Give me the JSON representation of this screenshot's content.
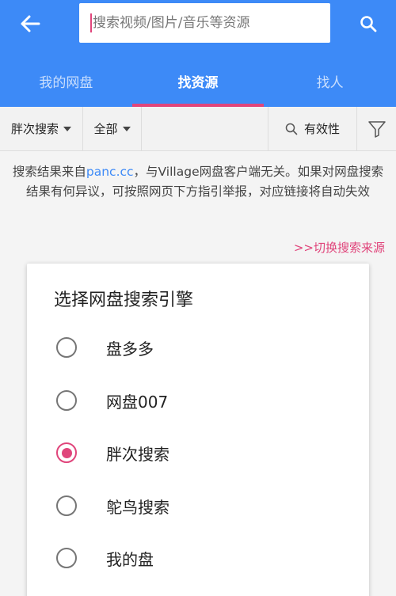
{
  "header": {
    "search_placeholder": "搜索视频/图片/音乐等资源"
  },
  "tabs": [
    {
      "label": "我的网盘",
      "active": false
    },
    {
      "label": "找资源",
      "active": true
    },
    {
      "label": "找人",
      "active": false
    }
  ],
  "filters": {
    "sort_label": "胖次搜索",
    "category_label": "全部",
    "validity_label": "有效性"
  },
  "notice": {
    "prefix": "搜索结果来自",
    "link": "panc.cc",
    "suffix": "，与Village网盘客户端无关。如果对网盘搜索结果有何异议，可按照网页下方指引举报，对应链接将自动失效"
  },
  "switch_source_label": ">>切换搜索来源",
  "dialog": {
    "title": "选择网盘搜索引擎",
    "options": [
      {
        "label": "盘多多",
        "checked": false
      },
      {
        "label": "网盘007",
        "checked": false
      },
      {
        "label": "胖次搜索",
        "checked": true
      },
      {
        "label": "鸵鸟搜索",
        "checked": false
      },
      {
        "label": "我的盘",
        "checked": false
      }
    ]
  },
  "colors": {
    "primary": "#3d8af7",
    "accent": "#e0457b"
  },
  "icons": {
    "back": "arrow-left-icon",
    "search": "search-icon",
    "dropdown": "caret-down-icon",
    "validity": "search-icon",
    "filter": "funnel-icon",
    "radio": "radio-icon"
  }
}
